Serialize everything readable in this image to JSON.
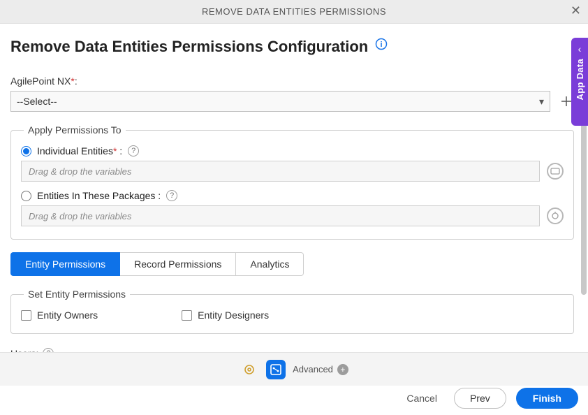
{
  "titlebar": {
    "title": "REMOVE DATA ENTITIES PERMISSIONS"
  },
  "page": {
    "heading": "Remove Data Entities Permissions Configuration"
  },
  "app_data_tab": {
    "label": "App Data"
  },
  "agilepoint": {
    "label": "AgilePoint NX",
    "required_mark": "*",
    "select_placeholder": "--Select--"
  },
  "apply_fieldset": {
    "legend": "Apply Permissions To",
    "individual": {
      "label": "Individual Entities",
      "required_mark": "*",
      "colon": " :",
      "placeholder": "Drag & drop the variables"
    },
    "packages": {
      "label": "Entities In These Packages :",
      "placeholder": "Drag & drop the variables"
    }
  },
  "tabs": [
    {
      "label": "Entity Permissions",
      "active": true
    },
    {
      "label": "Record Permissions",
      "active": false
    },
    {
      "label": "Analytics",
      "active": false
    }
  ],
  "entity_perm_fieldset": {
    "legend": "Set Entity Permissions",
    "owners": "Entity Owners",
    "designers": "Entity Designers"
  },
  "users": {
    "label": "Users:"
  },
  "toolbar": {
    "advanced": "Advanced"
  },
  "footer": {
    "cancel": "Cancel",
    "prev": "Prev",
    "finish": "Finish"
  }
}
